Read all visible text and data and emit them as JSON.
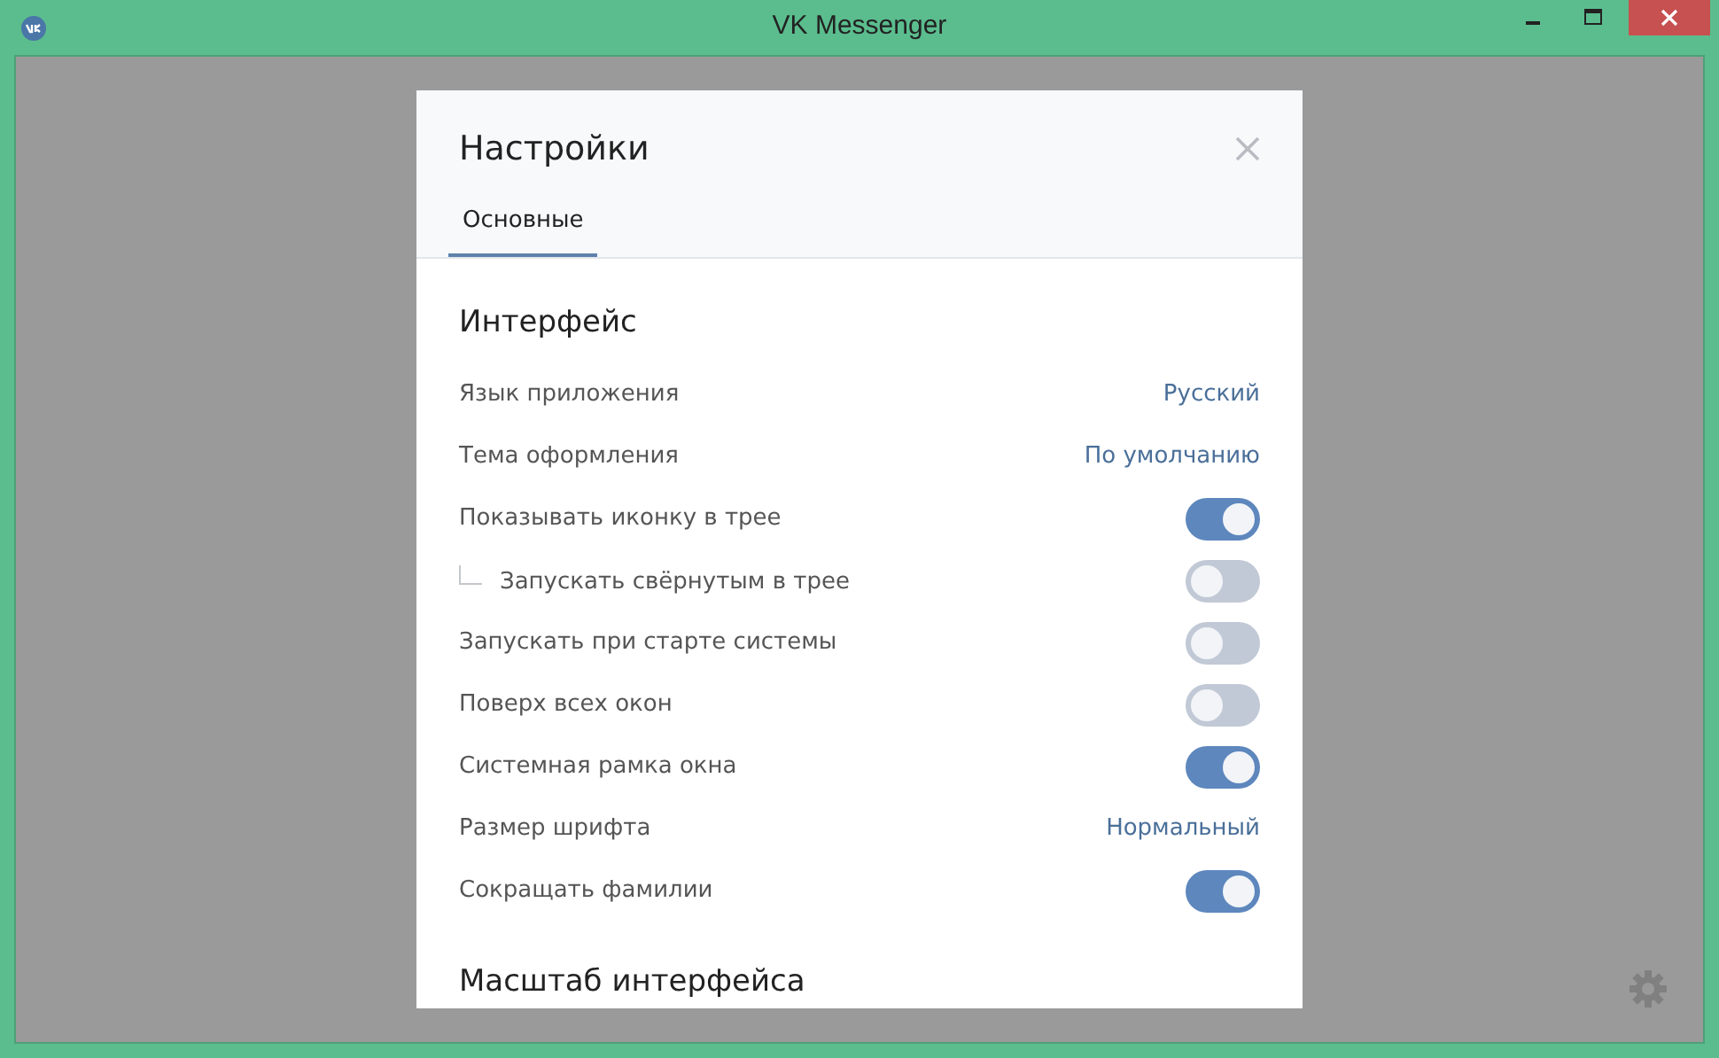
{
  "window": {
    "title": "VK Messenger"
  },
  "dialog": {
    "title": "Настройки",
    "tabs": [
      {
        "label": "Основные",
        "selected": true
      }
    ],
    "sections": [
      {
        "heading": "Интерфейс",
        "rows": [
          {
            "kind": "select",
            "label": "Язык приложения",
            "value": "Русский"
          },
          {
            "kind": "select",
            "label": "Тема оформления",
            "value": "По умолчанию"
          },
          {
            "kind": "toggle",
            "label": "Показывать иконку в трее",
            "on": true,
            "children": [
              {
                "kind": "toggle",
                "label": "Запускать свёрнутым в трее",
                "on": false
              }
            ]
          },
          {
            "kind": "toggle",
            "label": "Запускать при старте системы",
            "on": false
          },
          {
            "kind": "toggle",
            "label": "Поверх всех окон",
            "on": false
          },
          {
            "kind": "toggle",
            "label": "Системная рамка окна",
            "on": true
          },
          {
            "kind": "select",
            "label": "Размер шрифта",
            "value": "Нормальный"
          },
          {
            "kind": "toggle",
            "label": "Сокращать фамилии",
            "on": true
          }
        ]
      },
      {
        "heading": "Масштаб интерфейса"
      }
    ]
  }
}
